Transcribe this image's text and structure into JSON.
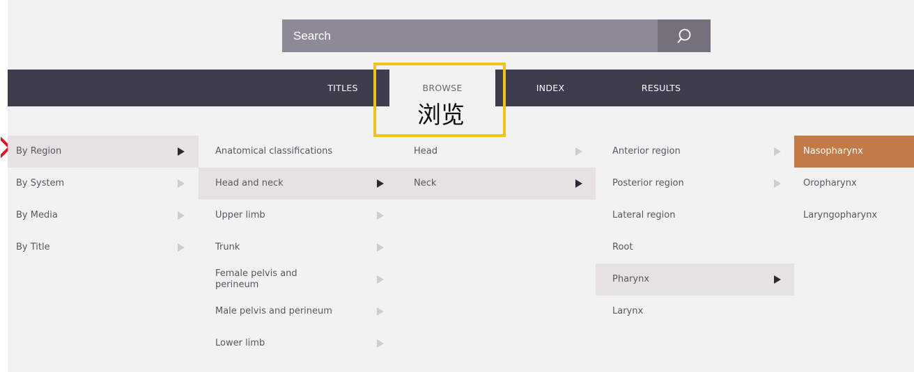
{
  "search": {
    "placeholder": "Search"
  },
  "nav": {
    "tabs": [
      {
        "label": "TITLES"
      },
      {
        "label": "BROWSE"
      },
      {
        "label": "INDEX"
      },
      {
        "label": "RESULTS"
      }
    ],
    "active_annotation": "浏览"
  },
  "columns": {
    "col1": [
      {
        "label": "By Region"
      },
      {
        "label": "By System"
      },
      {
        "label": "By Media"
      },
      {
        "label": "By Title"
      }
    ],
    "col2": [
      {
        "label": "Anatomical classifications"
      },
      {
        "label": "Head and neck"
      },
      {
        "label": "Upper limb"
      },
      {
        "label": "Trunk"
      },
      {
        "label": "Female pelvis and perineum"
      },
      {
        "label": "Male pelvis and perineum"
      },
      {
        "label": "Lower limb"
      }
    ],
    "col3": [
      {
        "label": "Head"
      },
      {
        "label": "Neck"
      }
    ],
    "col4": [
      {
        "label": "Anterior region"
      },
      {
        "label": "Posterior region"
      },
      {
        "label": "Lateral region"
      },
      {
        "label": "Root"
      },
      {
        "label": "Pharynx"
      },
      {
        "label": "Larynx"
      }
    ],
    "col5": [
      {
        "label": "Nasopharynx"
      },
      {
        "label": "Oropharynx"
      },
      {
        "label": "Laryngopharynx"
      }
    ]
  },
  "colors": {
    "navbar": "#3f3c4e",
    "search_field": "#8d8996",
    "search_button": "#75717c",
    "selected_row": "#e6e2e3",
    "active_leaf": "#c27a47",
    "annotation_box": "#f2c315",
    "annotation_marker": "#e0121a"
  },
  "icons": {
    "search": "search-icon",
    "submenu_arrow": "triangle-right-icon"
  }
}
